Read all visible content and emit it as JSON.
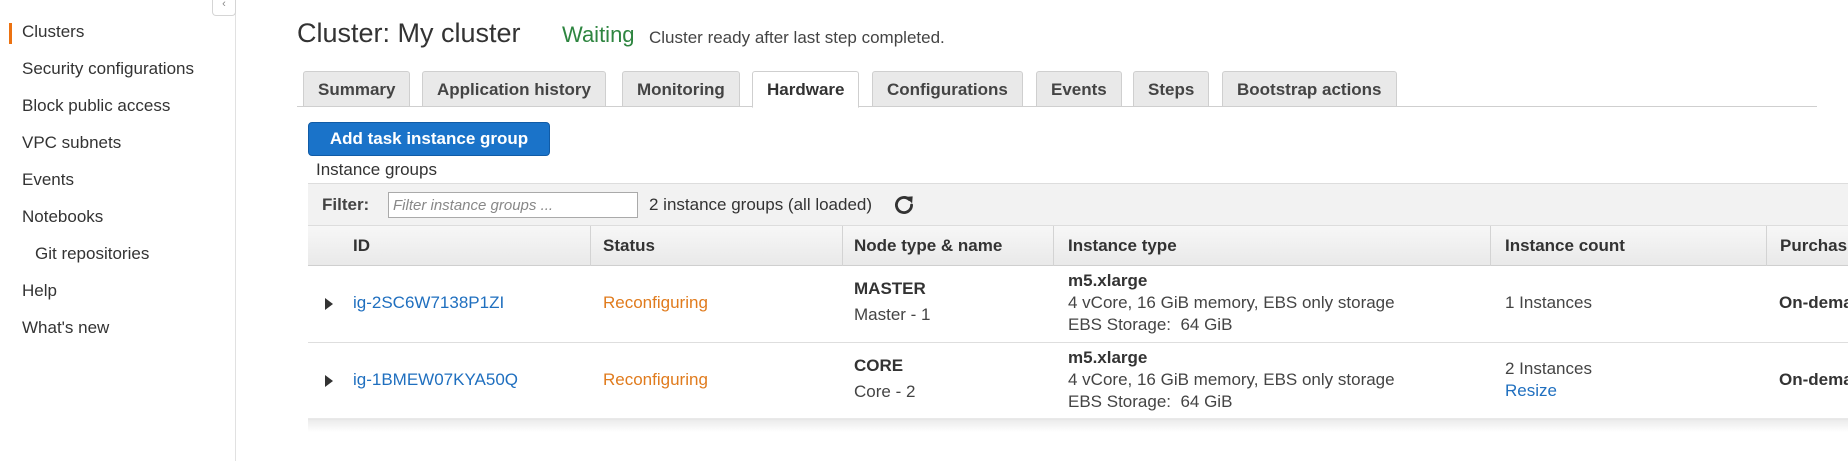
{
  "sidebar": {
    "collapse_glyph": "‹",
    "items": [
      {
        "label": "Clusters",
        "active": true
      },
      {
        "label": "Security configurations"
      },
      {
        "label": "Block public access"
      },
      {
        "label": "VPC subnets"
      },
      {
        "label": "Events"
      },
      {
        "label": "Notebooks"
      },
      {
        "label": "Git repositories",
        "sub": true
      },
      {
        "label": "Help"
      },
      {
        "label": "What's new"
      }
    ]
  },
  "header": {
    "title": "Cluster: My cluster",
    "state": "Waiting",
    "state_description": "Cluster ready after last step completed."
  },
  "tabs": [
    {
      "label": "Summary"
    },
    {
      "label": "Application history"
    },
    {
      "label": "Monitoring"
    },
    {
      "label": "Hardware",
      "active": true
    },
    {
      "label": "Configurations"
    },
    {
      "label": "Events"
    },
    {
      "label": "Steps"
    },
    {
      "label": "Bootstrap actions"
    }
  ],
  "actions": {
    "add_task_group": "Add task instance group"
  },
  "instance_groups": {
    "section_label": "Instance groups",
    "filter": {
      "label": "Filter:",
      "placeholder": "Filter instance groups ...",
      "value": "",
      "count_text": "2 instance groups (all loaded)",
      "refresh_icon": "refresh-icon"
    },
    "columns": [
      "ID",
      "Status",
      "Node type & name",
      "Instance type",
      "Instance count",
      "Purchas"
    ],
    "rows": [
      {
        "id": "ig-2SC6W7138P1ZI",
        "status": "Reconfiguring",
        "node_type": "MASTER",
        "node_name": "Master - 1",
        "instance_type": "m5.xlarge",
        "instance_spec": "4 vCore, 16 GiB memory, EBS only storage",
        "ebs_storage": "EBS Storage:  64 GiB",
        "instance_count": "1 Instances",
        "resize": "",
        "purchase": "On-dema"
      },
      {
        "id": "ig-1BMEW07KYA50Q",
        "status": "Reconfiguring",
        "node_type": "CORE",
        "node_name": "Core - 2",
        "instance_type": "m5.xlarge",
        "instance_spec": "4 vCore, 16 GiB memory, EBS only storage",
        "ebs_storage": "EBS Storage:  64 GiB",
        "instance_count": "2 Instances",
        "resize": "Resize",
        "purchase": "On-dema"
      }
    ]
  },
  "colors": {
    "accent": "#ec7211",
    "primary_button": "#1a73c9",
    "link": "#1f6fbf",
    "status_waiting": "#2e8540",
    "status_reconfiguring": "#e07b1d"
  }
}
